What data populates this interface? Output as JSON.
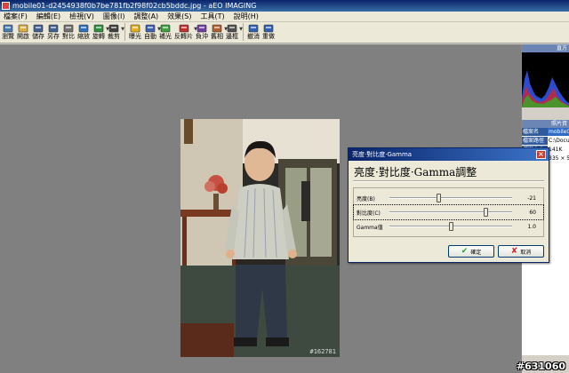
{
  "window": {
    "title": "mobile01-d2454938f0b7be781fb2f98f02cb5bddc.jpg - aEO IMAGING"
  },
  "menu": [
    {
      "id": "file",
      "label": "檔案(F)"
    },
    {
      "id": "edit",
      "label": "編輯(E)"
    },
    {
      "id": "view",
      "label": "檢視(V)"
    },
    {
      "id": "image",
      "label": "圖像(I)"
    },
    {
      "id": "adjust",
      "label": "調整(A)"
    },
    {
      "id": "effects",
      "label": "效果(S)"
    },
    {
      "id": "tools",
      "label": "工具(T)"
    },
    {
      "id": "help",
      "label": "說明(H)"
    }
  ],
  "toolbar": [
    {
      "id": "browse",
      "label": "瀏覽",
      "icon": "browse-icon",
      "color": "#4a7ab0",
      "dropdown": false,
      "sep_after": false
    },
    {
      "id": "open",
      "label": "開啟",
      "icon": "open-folder-icon",
      "color": "#d8b040",
      "dropdown": false,
      "sep_after": false
    },
    {
      "id": "save",
      "label": "儲存",
      "icon": "save-icon",
      "color": "#406090",
      "dropdown": false,
      "sep_after": false
    },
    {
      "id": "saveas",
      "label": "另存",
      "icon": "save-as-icon",
      "color": "#406090",
      "dropdown": false,
      "sep_after": false
    },
    {
      "id": "compare",
      "label": "對比",
      "icon": "compare-icon",
      "color": "#707070",
      "dropdown": false,
      "sep_after": false
    },
    {
      "id": "zoom",
      "label": "縮放",
      "icon": "zoom-icon",
      "color": "#3070c0",
      "dropdown": false,
      "sep_after": false
    },
    {
      "id": "rotate",
      "label": "旋轉",
      "icon": "rotate-icon",
      "color": "#2f8f3f",
      "dropdown": true,
      "sep_after": false
    },
    {
      "id": "crop",
      "label": "裁剪",
      "icon": "crop-icon",
      "color": "#404040",
      "dropdown": true,
      "sep_after": true
    },
    {
      "id": "exposure",
      "label": "曝光",
      "icon": "exposure-icon",
      "color": "#e0b020",
      "dropdown": false,
      "sep_after": false
    },
    {
      "id": "auto",
      "label": "自動",
      "icon": "auto-icon",
      "color": "#4060b0",
      "dropdown": true,
      "sep_after": false
    },
    {
      "id": "fill-light",
      "label": "補光",
      "icon": "fill-light-icon",
      "color": "#40a040",
      "dropdown": false,
      "sep_after": false
    },
    {
      "id": "invert",
      "label": "反轉片",
      "icon": "invert-icon",
      "color": "#c03030",
      "dropdown": true,
      "sep_after": false
    },
    {
      "id": "wash",
      "label": "負沖",
      "icon": "wash-icon",
      "color": "#7040a0",
      "dropdown": false,
      "sep_after": false
    },
    {
      "id": "sepia",
      "label": "舊相",
      "icon": "sepia-icon",
      "color": "#b06030",
      "dropdown": true,
      "sep_after": false
    },
    {
      "id": "frame",
      "label": "邊框",
      "icon": "frame-icon",
      "color": "#505050",
      "dropdown": true,
      "sep_after": true
    },
    {
      "id": "undo",
      "label": "撤消",
      "icon": "undo-icon",
      "color": "#3060b0",
      "dropdown": false,
      "sep_after": false
    },
    {
      "id": "redo",
      "label": "重做",
      "icon": "redo-icon",
      "color": "#3060b0",
      "dropdown": false,
      "sep_after": false
    }
  ],
  "right_panel": {
    "histogram_header": "直方",
    "info_header": "照片資",
    "info": [
      {
        "key": "檔案名",
        "value": "mobile0",
        "selected": true
      },
      {
        "key": "檔案路徑",
        "value": "C:\\Docu",
        "selected": false
      },
      {
        "key": "檔案大小",
        "value": "141K",
        "selected": false
      },
      {
        "key": "尺寸",
        "value": "335 × 5",
        "selected": false
      }
    ]
  },
  "photo": {
    "number": "#162781"
  },
  "dialog": {
    "title": "亮度·對比度·Gamma",
    "heading": "亮度·對比度·Gamma調整",
    "sliders": [
      {
        "id": "brightness",
        "label": "亮度(B)",
        "value": "-21",
        "position": 0.4,
        "selected": false
      },
      {
        "id": "contrast",
        "label": "對比度(C)",
        "value": "60",
        "position": 0.8,
        "selected": true
      },
      {
        "id": "gamma",
        "label": "Gamma值",
        "value": "1.0",
        "position": 0.5,
        "selected": false
      }
    ],
    "ok_label": "確定",
    "cancel_label": "取消"
  },
  "watermark": "#631060"
}
